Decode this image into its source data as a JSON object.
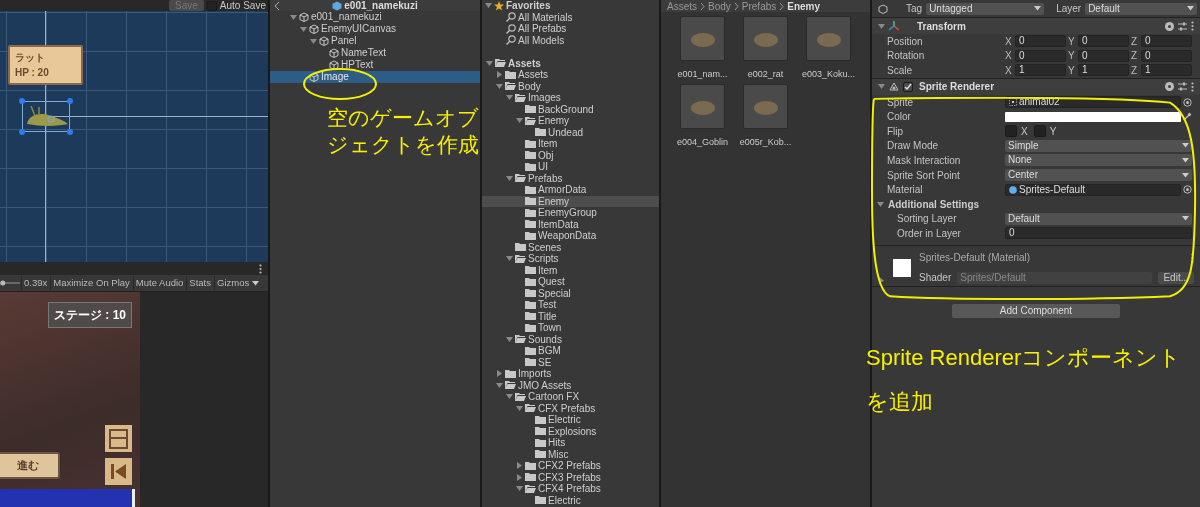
{
  "scene_view": {
    "save": {
      "label": "Save",
      "disabled": true
    },
    "auto_save": {
      "label": "Auto Save",
      "checked": false
    },
    "enemy_card": {
      "name": "ラット",
      "hp": "HP : 20"
    }
  },
  "game_toolbar": {
    "zoom": {
      "level": 0.05
    },
    "scale": "0.39x",
    "buttons": [
      "Maximize On Play",
      "Mute Audio",
      "Stats",
      "Gizmos"
    ]
  },
  "game_view": {
    "stage": "ステージ : 10",
    "advance_button": "進む"
  },
  "hierarchy": {
    "title": "e001_namekuzi",
    "items": [
      {
        "label": "e001_namekuzi",
        "selected": false,
        "expanded": true,
        "children": [
          {
            "label": "EnemyUICanvas",
            "selected": false,
            "expanded": true,
            "children": [
              {
                "label": "Panel",
                "selected": false,
                "expanded": true,
                "children": [
                  {
                    "label": "NameText",
                    "selected": false
                  },
                  {
                    "label": "HPText",
                    "selected": false
                  }
                ]
              }
            ]
          },
          {
            "label": "Image",
            "selected": true
          }
        ]
      }
    ]
  },
  "project": {
    "favorites": {
      "label": "Favorites",
      "expanded": true,
      "items": [
        {
          "label": "All Materials",
          "selected": false
        },
        {
          "label": "All Prefabs",
          "selected": false
        },
        {
          "label": "All Models",
          "selected": false
        }
      ]
    },
    "tree": [
      {
        "label": "Assets",
        "selected": false,
        "expanded": true,
        "children": [
          {
            "label": "Assets",
            "selected": false,
            "expanded": false
          },
          {
            "label": "Body",
            "selected": false,
            "expanded": true,
            "children": [
              {
                "label": "Images",
                "selected": false,
                "expanded": true,
                "children": [
                  {
                    "label": "BackGround",
                    "selected": false
                  },
                  {
                    "label": "Enemy",
                    "selected": false,
                    "expanded": true,
                    "children": [
                      {
                        "label": "Undead",
                        "selected": false
                      }
                    ]
                  },
                  {
                    "label": "Item",
                    "selected": false
                  },
                  {
                    "label": "Obj",
                    "selected": false
                  },
                  {
                    "label": "UI",
                    "selected": false
                  }
                ]
              },
              {
                "label": "Prefabs",
                "selected": false,
                "expanded": true,
                "children": [
                  {
                    "label": "ArmorData",
                    "selected": false
                  },
                  {
                    "label": "Enemy",
                    "selected": true
                  },
                  {
                    "label": "EnemyGroup",
                    "selected": false
                  },
                  {
                    "label": "ItemData",
                    "selected": false
                  },
                  {
                    "label": "WeaponData",
                    "selected": false
                  }
                ]
              },
              {
                "label": "Scenes",
                "selected": false
              },
              {
                "label": "Scripts",
                "selected": false,
                "expanded": true,
                "children": [
                  {
                    "label": "Item",
                    "selected": false
                  },
                  {
                    "label": "Quest",
                    "selected": false
                  },
                  {
                    "label": "Special",
                    "selected": false
                  },
                  {
                    "label": "Test",
                    "selected": false
                  },
                  {
                    "label": "Title",
                    "selected": false
                  },
                  {
                    "label": "Town",
                    "selected": false
                  }
                ]
              },
              {
                "label": "Sounds",
                "selected": false,
                "expanded": true,
                "children": [
                  {
                    "label": "BGM",
                    "selected": false
                  },
                  {
                    "label": "SE",
                    "selected": false
                  }
                ]
              }
            ]
          },
          {
            "label": "Imports",
            "selected": false,
            "expanded": false
          },
          {
            "label": "JMO Assets",
            "selected": false,
            "expanded": true,
            "children": [
              {
                "label": "Cartoon FX",
                "selected": false,
                "expanded": true,
                "children": [
                  {
                    "label": "CFX Prefabs",
                    "selected": false,
                    "expanded": true,
                    "children": [
                      {
                        "label": "Electric",
                        "selected": false
                      },
                      {
                        "label": "Explosions",
                        "selected": false
                      },
                      {
                        "label": "Hits",
                        "selected": false
                      },
                      {
                        "label": "Misc",
                        "selected": false
                      }
                    ]
                  },
                  {
                    "label": "CFX2 Prefabs",
                    "selected": false,
                    "expanded": false
                  },
                  {
                    "label": "CFX3 Prefabs",
                    "selected": false,
                    "expanded": false
                  },
                  {
                    "label": "CFX4 Prefabs",
                    "selected": false,
                    "expanded": true,
                    "children": [
                      {
                        "label": "Electric",
                        "selected": false
                      }
                    ]
                  }
                ]
              }
            ]
          }
        ]
      }
    ],
    "breadcrumb": [
      "Assets",
      "Body",
      "Prefabs",
      "Enemy"
    ],
    "assets": [
      {
        "label": "e001_nam..."
      },
      {
        "label": "e002_rat"
      },
      {
        "label": "e003_Koku..."
      },
      {
        "label": "e004_Goblin"
      },
      {
        "label": "e005r_Kob..."
      }
    ]
  },
  "inspector": {
    "tag": {
      "label": "Tag",
      "value": "Untagged"
    },
    "layer": {
      "label": "Layer",
      "value": "Default"
    },
    "transform": {
      "title": "Transform",
      "expanded": true,
      "rows": [
        {
          "label": "Position",
          "values": [
            {
              "axis": "X",
              "value": "0"
            },
            {
              "axis": "Y",
              "value": "0"
            },
            {
              "axis": "Z",
              "value": "0"
            }
          ]
        },
        {
          "label": "Rotation",
          "values": [
            {
              "axis": "X",
              "value": "0"
            },
            {
              "axis": "Y",
              "value": "0"
            },
            {
              "axis": "Z",
              "value": "0"
            }
          ]
        },
        {
          "label": "Scale",
          "values": [
            {
              "axis": "X",
              "value": "1"
            },
            {
              "axis": "Y",
              "value": "1"
            },
            {
              "axis": "Z",
              "value": "1"
            }
          ]
        }
      ]
    },
    "sprite_renderer": {
      "title": "Sprite Renderer",
      "enabled": true,
      "expanded": true,
      "fields": [
        {
          "kind": "object",
          "label": "Sprite",
          "value": "animal02"
        },
        {
          "kind": "color",
          "label": "Color",
          "color": "#ffffff"
        },
        {
          "kind": "flip",
          "label": "Flip",
          "toggles": [
            {
              "label": "X",
              "checked": false
            },
            {
              "label": "Y",
              "checked": false
            }
          ]
        },
        {
          "kind": "dropdown",
          "label": "Draw Mode",
          "value": "Simple"
        },
        {
          "kind": "dropdown",
          "label": "Mask Interaction",
          "value": "None"
        },
        {
          "kind": "dropdown",
          "label": "Sprite Sort Point",
          "value": "Center"
        },
        {
          "kind": "material",
          "label": "Material",
          "value": "Sprites-Default"
        },
        {
          "kind": "section",
          "label": "Additional Settings",
          "expanded": true,
          "children": [
            {
              "kind": "dropdown",
              "label": "Sorting Layer",
              "value": "Default"
            },
            {
              "kind": "number",
              "label": "Order in Layer",
              "value": "0"
            }
          ]
        }
      ]
    },
    "material": {
      "title": "Sprites-Default (Material)",
      "shader_label": "Shader",
      "shader": "Sprites/Default",
      "edit": "Edit...",
      "expanded": false
    },
    "add_component": "Add Component"
  },
  "annotations": [
    {
      "text": "空のゲームオブジェクトを作成"
    },
    {
      "text": "Sprite Rendererコンポーネントを追加"
    }
  ]
}
